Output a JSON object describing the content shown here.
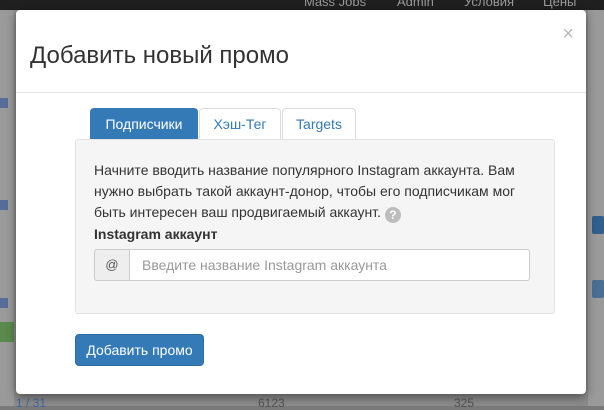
{
  "background": {
    "nav": [
      "Mass Jobs",
      "Admin",
      "Условия",
      "Цены"
    ],
    "bottom_values": [
      "1 / 31",
      "6123",
      "325"
    ]
  },
  "modal": {
    "title": "Добавить новый промо",
    "close_symbol": "×",
    "tabs": [
      {
        "label": "Подписчики",
        "active": true
      },
      {
        "label": "Хэш-Тег",
        "active": false
      },
      {
        "label": "Targets",
        "active": false
      }
    ],
    "description": "Начните вводить название популярного Instagram аккаунта. Вам нужно выбрать такой аккаунт-донор, чтобы его подписчикам мог быть интересен ваш продвигаемый аккаунт.",
    "help_symbol": "?",
    "field_label": "Instagram аккаунт",
    "input_prefix": "@",
    "input_placeholder": "Введите название Instagram аккаунта",
    "input_value": "",
    "submit_label": "Добавить промо"
  },
  "colors": {
    "primary": "#337ab7",
    "backdrop": "#8c8c8c"
  }
}
